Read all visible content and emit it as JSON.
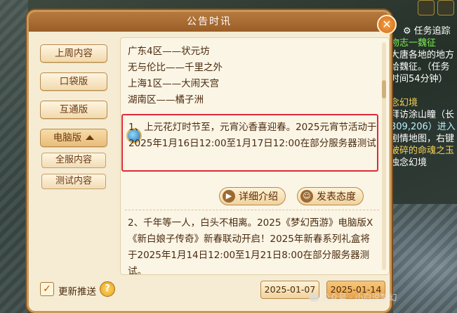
{
  "dialog": {
    "title": "公告时讯",
    "close_glyph": "✕"
  },
  "sidebar": {
    "buttons": [
      "上周内容",
      "口袋版",
      "互通版",
      "电脑版"
    ],
    "sub_buttons": [
      "全服内容",
      "测试内容"
    ]
  },
  "content": {
    "servers": [
      "广东4区——状元坊",
      "无与伦比——千里之外",
      "上海1区——大闹天宫",
      "湖南区——橘子洲"
    ],
    "notice1": "1、上元花灯时节至，元宵沁香喜迎春。2025元宵节活动于2025年1月16日12:00至1月17日12:00在部分服务器测试",
    "actions": {
      "details": "详细介绍",
      "comment": "发表态度"
    },
    "notice2": "2、千年等一人，白头不相离。2025《梦幻西游》电脑版X《新白娘子传奇》新春联动开启！2025年新春系列礼盒将于2025年1月14日12:00至1月21日8:00在部分服务器测试。"
  },
  "footer": {
    "checkbox_label": "更新推送",
    "checked": true,
    "help_glyph": "?",
    "dates": [
      "2025-01-07",
      "2025-01-14"
    ],
    "selected_date": "2025-01-14"
  },
  "quest_panel": {
    "header": "任务追踪",
    "lines": [
      {
        "text": "物志一魏征",
        "color": "g"
      },
      {
        "text": "大唐各地的地方",
        "color": "w"
      },
      {
        "text": "给魏征。（任务",
        "color": "w"
      },
      {
        "text": "时间54分钟）",
        "color": "w"
      },
      {
        "text": "",
        "color": "w"
      },
      {
        "text": "念幻境",
        "color": "y"
      },
      {
        "text": "拜访涂山瞳（长",
        "color": "w"
      },
      {
        "text": "309,206）进入",
        "color": "c"
      },
      {
        "text": "剧情地图，右键",
        "color": "w"
      },
      {
        "text": "破碎的命魂之玉",
        "color": "y"
      },
      {
        "text": "浊念幻境",
        "color": "w"
      }
    ]
  },
  "watermark": "公众号 · 小白说梦幻"
}
